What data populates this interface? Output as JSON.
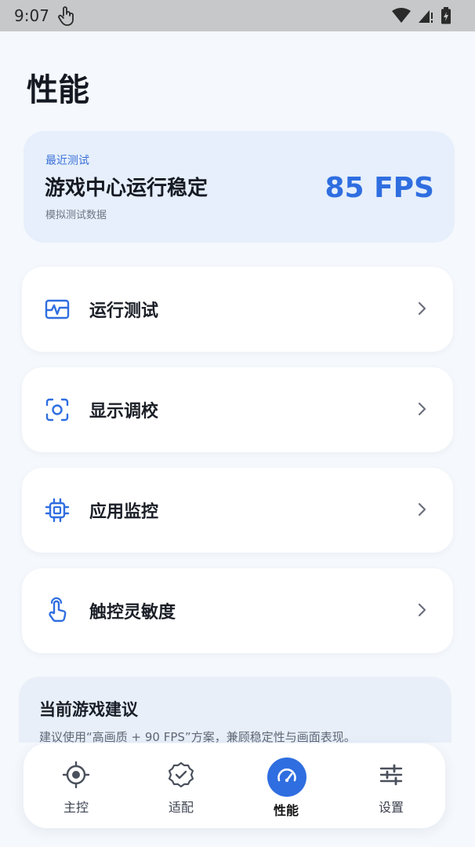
{
  "status_bar": {
    "time": "9:07",
    "icons": [
      "touch-icon",
      "wifi-icon",
      "cellular-icon",
      "battery-charging-icon"
    ]
  },
  "page": {
    "title": "性能"
  },
  "hero": {
    "kicker": "最近测试",
    "headline": "游戏中心运行稳定",
    "fps": "85 FPS",
    "subtitle": "模拟测试数据"
  },
  "menu": [
    {
      "label": "运行测试",
      "icon": "waveform-icon"
    },
    {
      "label": "显示调校",
      "icon": "scan-icon"
    },
    {
      "label": "应用监控",
      "icon": "chip-icon"
    },
    {
      "label": "触控灵敏度",
      "icon": "tap-hand-icon"
    }
  ],
  "tip": {
    "title": "当前游戏建议",
    "body": "建议使用“高画质 + 90 FPS”方案，兼顾稳定性与画面表现。"
  },
  "tabs": [
    {
      "label": "主控",
      "icon": "target-icon",
      "active": false
    },
    {
      "label": "适配",
      "icon": "badge-check-icon",
      "active": false
    },
    {
      "label": "性能",
      "icon": "speedometer-icon",
      "active": true
    },
    {
      "label": "设置",
      "icon": "sliders-icon",
      "active": false
    }
  ],
  "colors": {
    "accent": "#2f6ee0",
    "background": "#f5f8fc",
    "hero_background": "#e6effb",
    "card": "#ffffff",
    "status_bar": "#c7c8c9"
  }
}
